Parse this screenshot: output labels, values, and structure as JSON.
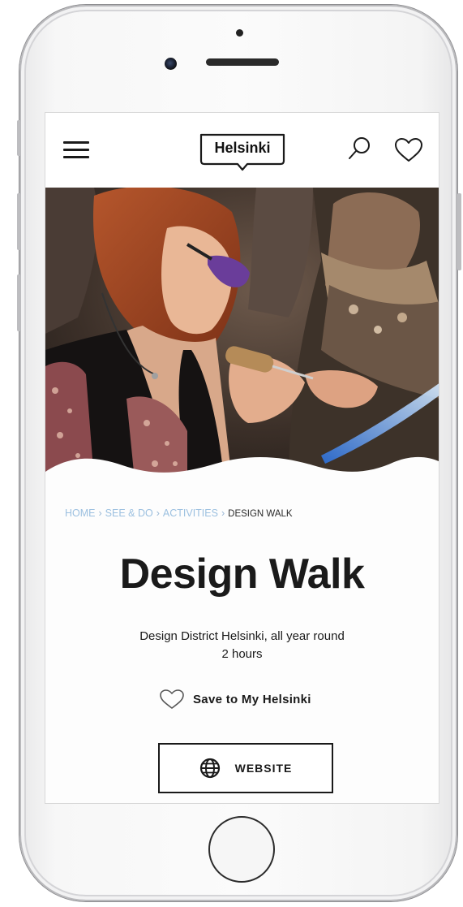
{
  "header": {
    "logo_text": "Helsinki"
  },
  "breadcrumb": {
    "items": [
      "HOME",
      "SEE & DO",
      "ACTIVITIES"
    ],
    "separator": "›",
    "current": "DESIGN WALK"
  },
  "page": {
    "title": "Design Walk",
    "location": "Design District Helsinki, all year round",
    "duration": "2 hours"
  },
  "actions": {
    "save_label": "Save to My Helsinki",
    "website_label": "WEBSITE"
  },
  "icons": {
    "menu": "hamburger-icon",
    "search": "search-icon",
    "favorites": "heart-icon",
    "save": "heart-outline-icon",
    "website": "globe-icon"
  },
  "colors": {
    "breadcrumb_link": "#9cc0e0",
    "text": "#1a1a1a"
  }
}
